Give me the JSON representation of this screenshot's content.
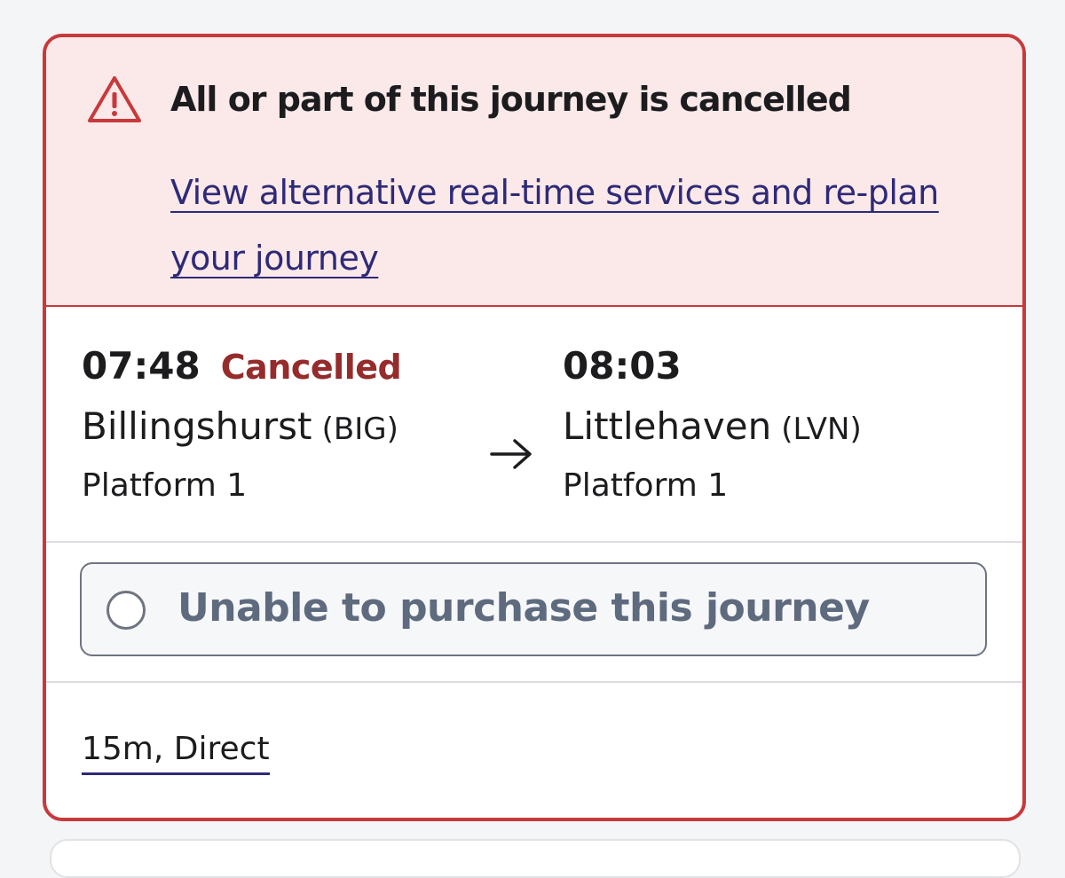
{
  "alert": {
    "title": "All or part of this journey is cancelled",
    "link_text": "View alternative real-time services and re-plan your journey",
    "icon": "warning-triangle-icon",
    "colors": {
      "background": "#fbe8e8",
      "border": "#c8393b",
      "link": "#2e2a78"
    }
  },
  "journey": {
    "origin": {
      "time": "07:48",
      "status": "Cancelled",
      "station": "Billingshurst",
      "code": "(BIG)",
      "platform": "Platform 1"
    },
    "destination": {
      "time": "08:03",
      "station": "Littlehaven",
      "code": "(LVN)",
      "platform": "Platform 1"
    },
    "arrow_icon": "arrow-right-icon",
    "status_color": "#962b2b"
  },
  "purchase": {
    "label": "Unable to purchase this journey"
  },
  "summary": {
    "duration": "15m, Direct"
  }
}
